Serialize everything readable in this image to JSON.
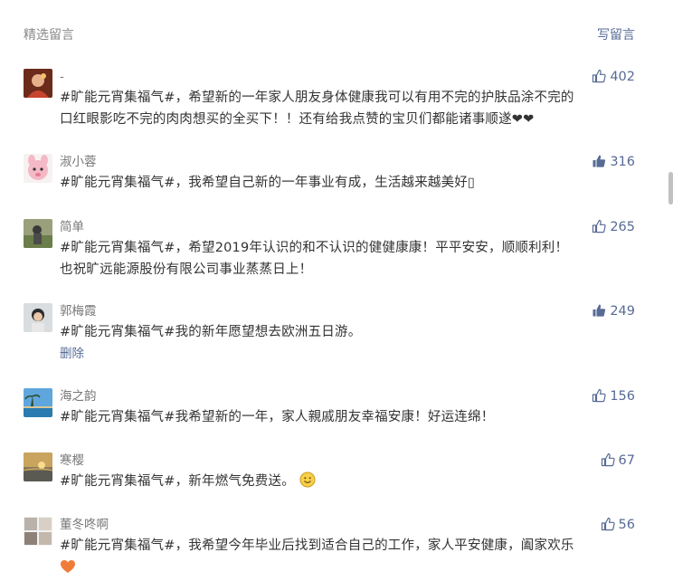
{
  "header": {
    "title": "精选留言",
    "write_label": "写留言"
  },
  "comments": [
    {
      "nickname": "-",
      "likes": "402",
      "liked": false,
      "lines": [
        "#旷能元宵集福气#，希望新的一年家人朋友身体健康我可以有用不完的护肤品涂不完的",
        "口红眼影吃不完的肉肉想买的全买下！！还有给我点赞的宝贝们都能诸事顺遂❤❤"
      ]
    },
    {
      "nickname": "淑小蓉",
      "likes": "316",
      "liked": true,
      "lines": [
        "#旷能元宵集福气#，我希望自己新的一年事业有成，生活越来越美好▯"
      ]
    },
    {
      "nickname": "简单",
      "likes": "265",
      "liked": false,
      "lines": [
        "#旷能元宵集福气#，希望2019年认识的和不认识的健健康康！平平安安，顺顺利利！",
        "也祝旷远能源股份有限公司事业蒸蒸日上！"
      ]
    },
    {
      "nickname": "郭梅霞",
      "likes": "249",
      "liked": true,
      "lines": [
        "#旷能元宵集福气#我的新年愿望想去欧洲五日游。"
      ],
      "delete_label": "删除"
    },
    {
      "nickname": "海之韵",
      "likes": "156",
      "liked": false,
      "lines": [
        "#旷能元宵集福气#我希望新的一年，家人親戚朋友幸福安康！好运连绵！"
      ]
    },
    {
      "nickname": "寒樱",
      "likes": "67",
      "liked": false,
      "lines": [
        "#旷能元宵集福气#，新年燃气免费送。"
      ],
      "emoji": "smile-emoji"
    },
    {
      "nickname": "董冬咚啊",
      "likes": "56",
      "liked": false,
      "lines": [
        "#旷能元宵集福气#，我希望今年毕业后找到适合自己的工作，家人平安健康，阖家欢乐"
      ],
      "emoji_line": "heart-emoji"
    }
  ],
  "colors": {
    "link": "#576b95",
    "meta": "#787878",
    "text": "#333333"
  }
}
